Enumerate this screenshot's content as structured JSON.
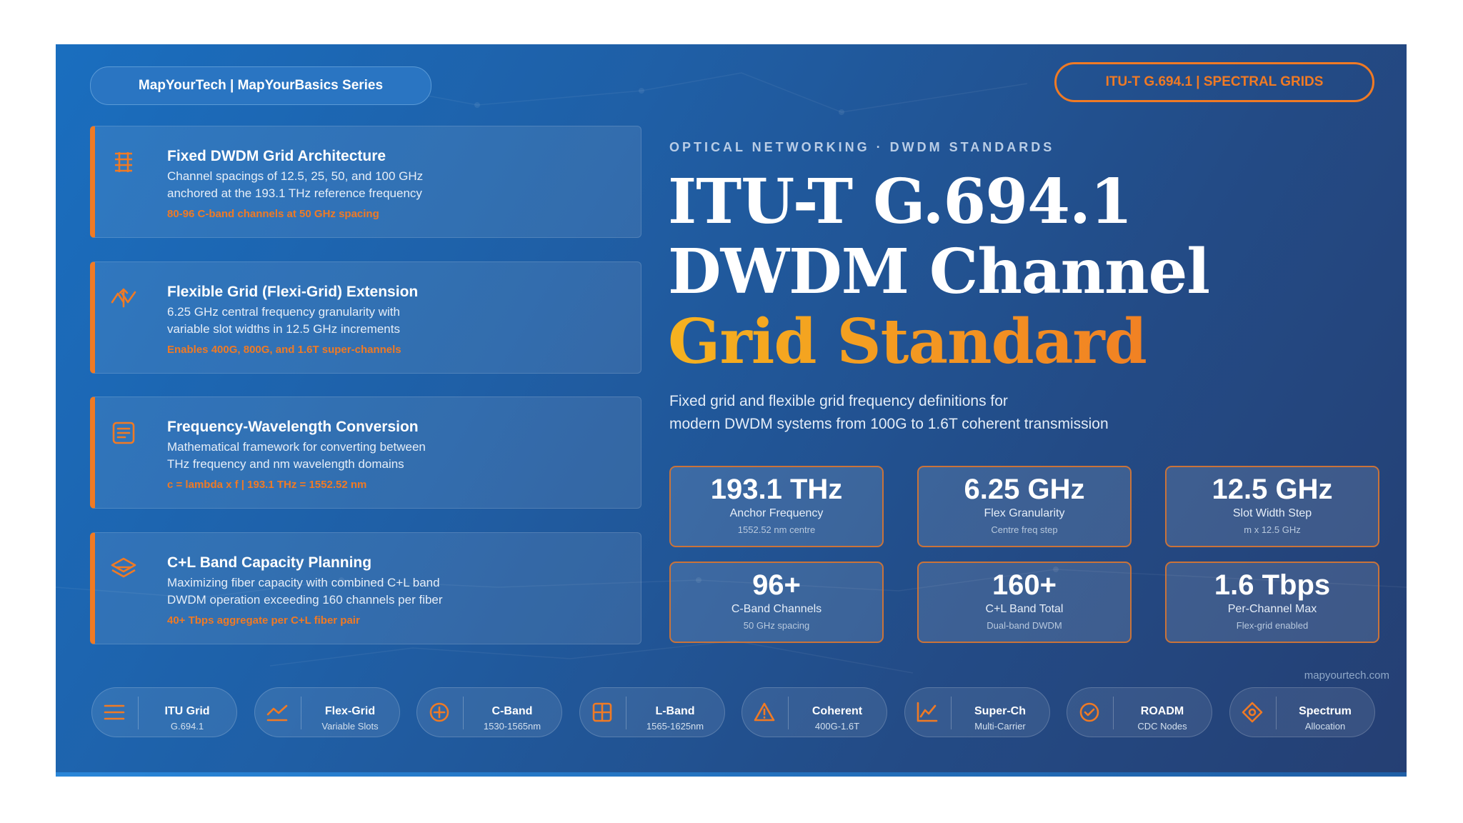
{
  "brand": "MapYourTech | MapYourBasics Series",
  "standard_tag": "ITU-T G.694.1 | SPECTRAL GRIDS",
  "eyebrow": "OPTICAL NETWORKING · DWDM STANDARDS",
  "title": {
    "line1": "ITU-T G.694.1",
    "line2": "DWDM Channel",
    "line3": "Grid Standard"
  },
  "subtitle": {
    "line1": "Fixed grid and flexible grid frequency definitions for",
    "line2": "modern DWDM systems from 100G to 1.6T coherent transmission"
  },
  "cards": [
    {
      "icon": "grid-icon",
      "title": "Fixed DWDM Grid Architecture",
      "desc1": "Channel spacings of 12.5, 25, 50, and 100 GHz",
      "desc2": "anchored at the 193.1 THz reference frequency",
      "note": "80-96 C-band channels at 50 GHz spacing"
    },
    {
      "icon": "flex-arrows-icon",
      "title": "Flexible Grid (Flexi-Grid) Extension",
      "desc1": "6.25 GHz central frequency granularity with",
      "desc2": "variable slot widths in 12.5 GHz increments",
      "note": "Enables 400G, 800G, and 1.6T super-channels"
    },
    {
      "icon": "document-icon",
      "title": "Frequency-Wavelength Conversion",
      "desc1": "Mathematical framework for converting between",
      "desc2": "THz frequency and nm wavelength domains",
      "note": "c = lambda x f | 193.1 THz = 1552.52 nm"
    },
    {
      "icon": "layers-icon",
      "title": "C+L Band Capacity Planning",
      "desc1": "Maximizing fiber capacity with combined C+L band",
      "desc2": "DWDM operation exceeding 160 channels per fiber",
      "note": "40+ Tbps aggregate per C+L fiber pair"
    }
  ],
  "stats": [
    {
      "value": "193.1 THz",
      "label": "Anchor Frequency",
      "sub": "1552.52 nm centre"
    },
    {
      "value": "6.25 GHz",
      "label": "Flex Granularity",
      "sub": "Centre freq step"
    },
    {
      "value": "12.5 GHz",
      "label": "Slot Width Step",
      "sub": "m x 12.5 GHz"
    },
    {
      "value": "96+",
      "label": "C-Band Channels",
      "sub": "50 GHz spacing"
    },
    {
      "value": "160+",
      "label": "C+L Band Total",
      "sub": "Dual-band DWDM"
    },
    {
      "value": "1.6 Tbps",
      "label": "Per-Channel Max",
      "sub": "Flex-grid enabled"
    }
  ],
  "credit": "mapyourtech.com",
  "chips": [
    {
      "icon": "menu-lines-icon",
      "title": "ITU Grid",
      "sub": "G.694.1"
    },
    {
      "icon": "line-chart-icon",
      "title": "Flex-Grid",
      "sub": "Variable Slots"
    },
    {
      "icon": "plus-circle-icon",
      "title": "C-Band",
      "sub": "1530-1565nm"
    },
    {
      "icon": "square-grid-icon",
      "title": "L-Band",
      "sub": "1565-1625nm"
    },
    {
      "icon": "warning-triangle-icon",
      "title": "Coherent",
      "sub": "400G-1.6T"
    },
    {
      "icon": "trend-chart-icon",
      "title": "Super-Ch",
      "sub": "Multi-Carrier"
    },
    {
      "icon": "check-circle-icon",
      "title": "ROADM",
      "sub": "CDC Nodes"
    },
    {
      "icon": "diamond-icon",
      "title": "Spectrum",
      "sub": "Allocation"
    }
  ],
  "colors": {
    "accent": "#f07a24",
    "gold": "#f6b21f",
    "bg": "#1f5fa6"
  }
}
